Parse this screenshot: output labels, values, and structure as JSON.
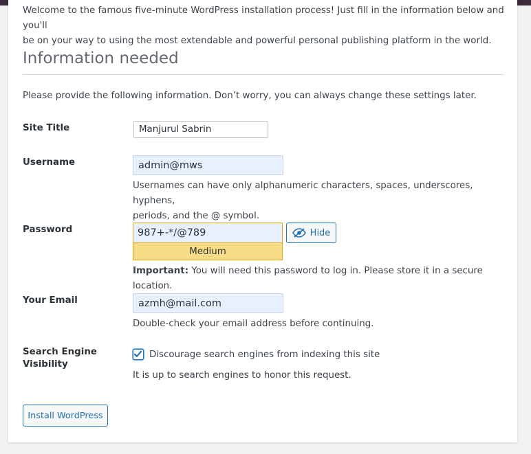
{
  "intro_line1": "Welcome to the famous five-minute WordPress installation process! Just fill in the information below and you'll",
  "intro_line2": "be on your way to using the most extendable and powerful personal publishing platform in the world.",
  "heading": "Information needed",
  "instructions": "Please provide the following information. Don’t worry, you can always change these settings later.",
  "fields": {
    "site_title": {
      "label": "Site Title",
      "value": "Manjurul Sabrin"
    },
    "username": {
      "label": "Username",
      "value": "admin@mws",
      "help_line1": "Usernames can have only alphanumeric characters, spaces, underscores, hyphens,",
      "help_line2": "periods, and the @ symbol."
    },
    "password": {
      "label": "Password",
      "value": "987+-*/@789",
      "strength": "Medium",
      "hide_label": "Hide",
      "important_label": "Important:",
      "important_text": " You will need this password to log in. Please store it in a secure location."
    },
    "email": {
      "label": "Your Email",
      "value": "azmh@mail.com",
      "help": "Double-check your email address before continuing."
    },
    "visibility": {
      "label_line1": "Search Engine",
      "label_line2": "Visibility",
      "checkbox_label": "Discourage search engines from indexing this site",
      "checked": true,
      "help": "It is up to search engines to honor this request."
    }
  },
  "install_button": "Install WordPress",
  "colors": {
    "accent": "#2271b1",
    "strength_medium": "#f8dd86",
    "autofill_bg": "#e8f0fe",
    "admin_bar": "#3b2a3a"
  },
  "icons": {
    "hide": "eye-slash-icon",
    "check": "checkmark-icon"
  }
}
